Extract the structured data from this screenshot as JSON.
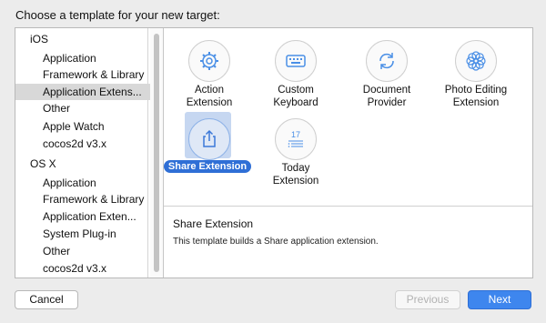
{
  "dialog": {
    "title": "Choose a template for your new target:"
  },
  "sidebar": {
    "items": [
      {
        "label": "iOS",
        "type": "head"
      },
      {
        "label": "Application",
        "type": "child"
      },
      {
        "label": "Framework & Library",
        "type": "child"
      },
      {
        "label": "Application Extens...",
        "type": "child",
        "selected": true
      },
      {
        "label": "Other",
        "type": "child"
      },
      {
        "label": "Apple Watch",
        "type": "child"
      },
      {
        "label": "cocos2d v3.x",
        "type": "child"
      },
      {
        "label": "OS X",
        "type": "head"
      },
      {
        "label": "Application",
        "type": "child"
      },
      {
        "label": "Framework & Library",
        "type": "child"
      },
      {
        "label": "Application Exten...",
        "type": "child"
      },
      {
        "label": "System Plug-in",
        "type": "child"
      },
      {
        "label": "Other",
        "type": "child"
      },
      {
        "label": "cocos2d v3.x",
        "type": "child"
      }
    ]
  },
  "templates": [
    {
      "label1": "Action",
      "label2": "Extension",
      "icon": "gear-icon"
    },
    {
      "label1": "Custom",
      "label2": "Keyboard",
      "icon": "keyboard-icon"
    },
    {
      "label1": "Document",
      "label2": "Provider",
      "icon": "sync-icon"
    },
    {
      "label1": "Photo Editing",
      "label2": "Extension",
      "icon": "flower-icon"
    },
    {
      "label1": "Share Extension",
      "label2": "",
      "icon": "share-icon",
      "selected": true
    },
    {
      "label1": "Today",
      "label2": "Extension",
      "icon": "calendar-icon",
      "day": "17"
    }
  ],
  "detail": {
    "title": "Share Extension",
    "description": "This template builds a Share application extension."
  },
  "buttons": {
    "cancel": "Cancel",
    "previous": "Previous",
    "next": "Next"
  },
  "colors": {
    "accent": "#3e86ee",
    "selection": "#2f6fd6",
    "sidebar_selected": "#d8d8d8"
  }
}
